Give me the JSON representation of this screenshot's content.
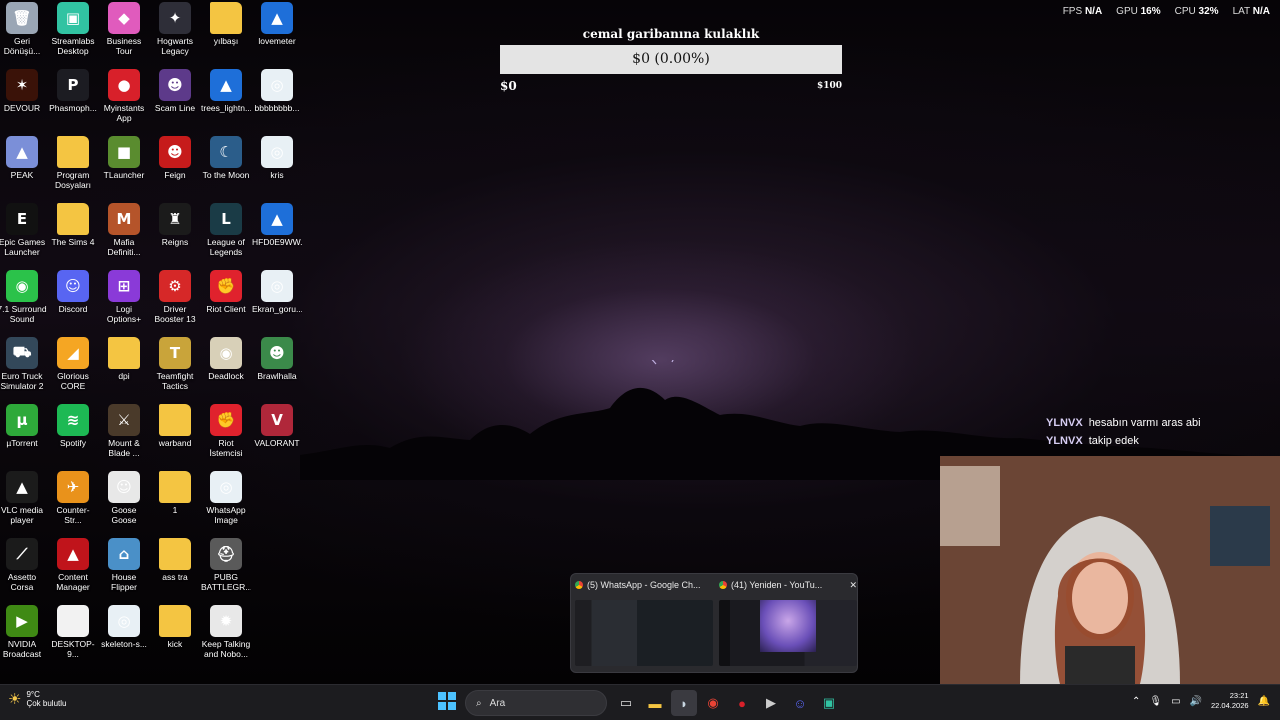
{
  "desktop_icons": [
    {
      "label": "Geri\nDönüşü...",
      "icon": "recycle-bin-icon",
      "color": "#9aa6b5",
      "glyph": "🗑"
    },
    {
      "label": "Streamlabs\nDesktop",
      "icon": "streamlabs-icon",
      "color": "#31c3a2",
      "glyph": "▣"
    },
    {
      "label": "Business Tour\n- Online M...",
      "icon": "business-tour-icon",
      "color": "#e05bbd",
      "glyph": "◆"
    },
    {
      "label": "Hogwarts\nLegacy",
      "icon": "hogwarts-icon",
      "color": "#2e2e38",
      "glyph": "✦"
    },
    {
      "label": "yılbaşı",
      "icon": "folder-icon",
      "color": "#f4c542",
      "glyph": ""
    },
    {
      "label": "lovemeter",
      "icon": "document-icon",
      "color": "#1e6fd9",
      "glyph": "▲"
    },
    {
      "label": "DEVOUR",
      "icon": "devour-icon",
      "color": "#3a1208",
      "glyph": "✶"
    },
    {
      "label": "Phasmoph...",
      "icon": "phasmophobia-icon",
      "color": "#1c1c22",
      "glyph": "P"
    },
    {
      "label": "Myinstants\nApp",
      "icon": "myinstants-icon",
      "color": "#d8202a",
      "glyph": "●"
    },
    {
      "label": "Scam Line",
      "icon": "scam-line-icon",
      "color": "#5d3a8a",
      "glyph": "☻"
    },
    {
      "label": "trees_lightn...",
      "icon": "image-file-icon",
      "color": "#1e6fd9",
      "glyph": "▲"
    },
    {
      "label": "bbbbbbbb...",
      "icon": "image-file-icon",
      "color": "#e8f0f5",
      "glyph": "◎"
    },
    {
      "label": "PEAK",
      "icon": "peak-icon",
      "color": "#7b8fd8",
      "glyph": "▲"
    },
    {
      "label": "Program\nDosyaları",
      "icon": "folder-icon",
      "color": "#f4c542",
      "glyph": ""
    },
    {
      "label": "TLauncher",
      "icon": "tlauncher-icon",
      "color": "#5a8c2f",
      "glyph": "■"
    },
    {
      "label": "Feign",
      "icon": "feign-icon",
      "color": "#c61b1b",
      "glyph": "☻"
    },
    {
      "label": "To the Moon",
      "icon": "to-the-moon-icon",
      "color": "#2b5d8a",
      "glyph": "☾"
    },
    {
      "label": "kris",
      "icon": "image-file-icon",
      "color": "#e8f0f5",
      "glyph": "◎"
    },
    {
      "label": "Epic Games\nLauncher",
      "icon": "epic-games-icon",
      "color": "#111111",
      "glyph": "E"
    },
    {
      "label": "The Sims 4",
      "icon": "folder-icon",
      "color": "#f4c542",
      "glyph": ""
    },
    {
      "label": "Mafia\nDefiniti...",
      "icon": "mafia-icon",
      "color": "#b5542a",
      "glyph": "M"
    },
    {
      "label": "Reigns",
      "icon": "reigns-icon",
      "color": "#1b1b1b",
      "glyph": "♜"
    },
    {
      "label": "League of\nLegends",
      "icon": "league-of-legends-icon",
      "color": "#1a3b46",
      "glyph": "L"
    },
    {
      "label": "HFD0E9WW...",
      "icon": "image-file-icon",
      "color": "#1e6fd9",
      "glyph": "▲"
    },
    {
      "label": "7.1 Surround\nSound",
      "icon": "surround-sound-icon",
      "color": "#2bc24a",
      "glyph": "◉"
    },
    {
      "label": "Discord",
      "icon": "discord-icon",
      "color": "#5865f2",
      "glyph": "☺"
    },
    {
      "label": "Logi\nOptions+",
      "icon": "logi-options-icon",
      "color": "#8a3ad8",
      "glyph": "⊞"
    },
    {
      "label": "Driver\nBooster 13",
      "icon": "driver-booster-icon",
      "color": "#d62828",
      "glyph": "⚙"
    },
    {
      "label": "Riot Client",
      "icon": "riot-client-icon",
      "color": "#e0222d",
      "glyph": "✊"
    },
    {
      "label": "Ekran_goru...",
      "icon": "image-file-icon",
      "color": "#e8f0f5",
      "glyph": "◎"
    },
    {
      "label": "Euro Truck\nSimulator 2",
      "icon": "euro-truck-icon",
      "color": "#33485a",
      "glyph": "⛟"
    },
    {
      "label": "Glorious\nCORE",
      "icon": "glorious-core-icon",
      "color": "#f5a623",
      "glyph": "◢"
    },
    {
      "label": "dpi",
      "icon": "folder-icon",
      "color": "#f4c542",
      "glyph": ""
    },
    {
      "label": "Teamfight\nTactics",
      "icon": "teamfight-tactics-icon",
      "color": "#c9a43a",
      "glyph": "T"
    },
    {
      "label": "Deadlock",
      "icon": "deadlock-icon",
      "color": "#d8d0b8",
      "glyph": "◉"
    },
    {
      "label": "Brawlhalla",
      "icon": "brawlhalla-icon",
      "color": "#3b8a4a",
      "glyph": "☻"
    },
    {
      "label": "µTorrent",
      "icon": "utorrent-icon",
      "color": "#2ea93a",
      "glyph": "µ"
    },
    {
      "label": "Spotify",
      "icon": "spotify-icon",
      "color": "#1db954",
      "glyph": "≋"
    },
    {
      "label": "Mount &\nBlade ...",
      "icon": "mount-blade-icon",
      "color": "#4a3a2a",
      "glyph": "⚔"
    },
    {
      "label": "warband",
      "icon": "folder-icon",
      "color": "#f4c542",
      "glyph": ""
    },
    {
      "label": "Riot İstemcisi",
      "icon": "riot-client-icon",
      "color": "#e0222d",
      "glyph": "✊"
    },
    {
      "label": "VALORANT",
      "icon": "valorant-icon",
      "color": "#b0273a",
      "glyph": "V"
    },
    {
      "label": "VLC media\nplayer",
      "icon": "vlc-icon",
      "color": "#1b1b1b",
      "glyph": "▲"
    },
    {
      "label": "Counter-Str...\n2",
      "icon": "counter-strike-icon",
      "color": "#e9921b",
      "glyph": "✈"
    },
    {
      "label": "Goose Goose\nDuck",
      "icon": "goose-goose-duck-icon",
      "color": "#e8e8e8",
      "glyph": "☺"
    },
    {
      "label": "1",
      "icon": "folder-icon",
      "color": "#f4c542",
      "glyph": ""
    },
    {
      "label": "WhatsApp\nImage 2026...",
      "icon": "image-file-icon",
      "color": "#e8f0f5",
      "glyph": "◎"
    },
    {
      "label": "",
      "icon": "",
      "color": "",
      "glyph": ""
    },
    {
      "label": "Assetto Corsa",
      "icon": "assetto-corsa-icon",
      "color": "#1b1b1b",
      "glyph": "⟋"
    },
    {
      "label": "Content\nManager",
      "icon": "content-manager-icon",
      "color": "#c0141b",
      "glyph": "▲"
    },
    {
      "label": "House\nFlipper",
      "icon": "house-flipper-icon",
      "color": "#4a90c8",
      "glyph": "⌂"
    },
    {
      "label": "ass tra",
      "icon": "folder-icon",
      "color": "#f4c542",
      "glyph": ""
    },
    {
      "label": "PUBG\nBATTLEGR...",
      "icon": "pubg-icon",
      "color": "#5a5a5a",
      "glyph": "⛑"
    },
    {
      "label": "",
      "icon": "",
      "color": "",
      "glyph": ""
    },
    {
      "label": "NVIDIA\nBroadcast",
      "icon": "nvidia-broadcast-icon",
      "color": "#3f8a14",
      "glyph": "▶"
    },
    {
      "label": "DESKTOP-9...",
      "icon": "blank-file-icon",
      "color": "#f2f2f2",
      "glyph": ""
    },
    {
      "label": "skeleton-s...",
      "icon": "image-file-icon",
      "color": "#e8f0f5",
      "glyph": "◎"
    },
    {
      "label": "kick",
      "icon": "folder-icon",
      "color": "#f4c542",
      "glyph": ""
    },
    {
      "label": "Keep Talking\nand Nobo...",
      "icon": "keep-talking-icon",
      "color": "#e8e8e8",
      "glyph": "✹"
    },
    {
      "label": "",
      "icon": "",
      "color": "",
      "glyph": ""
    }
  ],
  "goal": {
    "title": "cemal garibanına kulaklık",
    "progress_text": "$0 (0.00%)",
    "progress": 0,
    "min_label": "$0",
    "max_label": "$100"
  },
  "perf": [
    {
      "label": "FPS",
      "value": "N/A"
    },
    {
      "label": "GPU",
      "value": "16%"
    },
    {
      "label": "CPU",
      "value": "32%"
    },
    {
      "label": "LAT",
      "value": "N/A"
    }
  ],
  "chat": [
    {
      "user": "YLNVX",
      "message": "hesabın varmı aras abi"
    },
    {
      "user": "YLNVX",
      "message": "takip edek"
    }
  ],
  "previews": [
    {
      "title": "(5) WhatsApp - Google Ch...",
      "icon": "chrome-icon",
      "closable": false
    },
    {
      "title": "(41) Yeniden - YouTu...",
      "icon": "chrome-icon",
      "closable": true
    }
  ],
  "close_glyph": "✕",
  "taskbar": {
    "weather_temp": "9°C",
    "weather_desc": "Çok bulutlu",
    "search_placeholder": "Ara",
    "apps": [
      {
        "name": "task-view",
        "glyph": "▭",
        "color": "#dddddd",
        "active": false
      },
      {
        "name": "file-explorer",
        "glyph": "▬",
        "color": "#f4c542",
        "active": false
      },
      {
        "name": "steam",
        "glyph": "◗",
        "color": "#c7d5e0",
        "active": true
      },
      {
        "name": "chrome",
        "glyph": "◉",
        "color": "#ea4335",
        "active": false
      },
      {
        "name": "myinstants",
        "glyph": "●",
        "color": "#d8202a",
        "active": false
      },
      {
        "name": "terminal",
        "glyph": "▶",
        "color": "#cccccc",
        "active": false
      },
      {
        "name": "discord",
        "glyph": "☺",
        "color": "#5865f2",
        "active": false
      },
      {
        "name": "streamlabs",
        "glyph": "▣",
        "color": "#31c3a2",
        "active": false
      }
    ],
    "clock_time": "23:21",
    "clock_date": "22.04.2026"
  }
}
